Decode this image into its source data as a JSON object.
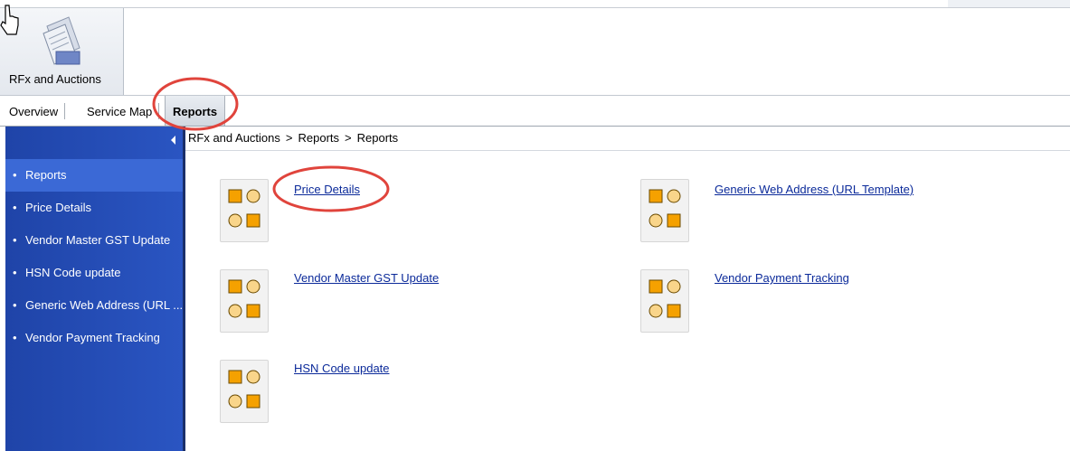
{
  "app": {
    "workcenter_label": "RFx and Auctions"
  },
  "nav": {
    "tabs": [
      "Overview",
      "Service Map",
      "Reports"
    ],
    "active_tab": "Reports"
  },
  "sidebar": {
    "items": [
      "Reports",
      "Price Details",
      "Vendor Master GST Update",
      "HSN Code update",
      "Generic Web Address (URL ...",
      "Vendor Payment Tracking"
    ],
    "selected": "Reports"
  },
  "breadcrumb": {
    "parts": [
      "RFx and Auctions",
      "Reports",
      "Reports"
    ],
    "separator": ">"
  },
  "reports": {
    "left": [
      "Price Details",
      "Vendor Master GST Update",
      "HSN Code update"
    ],
    "right": [
      "Generic Web Address (URL Template)",
      "Vendor Payment Tracking"
    ]
  },
  "colors": {
    "sidebar_bg": "#2550b8",
    "link": "#0b2a9a",
    "annotation": "#e0443c",
    "icon_orange": "#f5a100"
  },
  "icons": {
    "workcenter": "rfx-documents-icon",
    "report": "report-shapes-icon",
    "cursor": "hand-pointer-icon"
  }
}
